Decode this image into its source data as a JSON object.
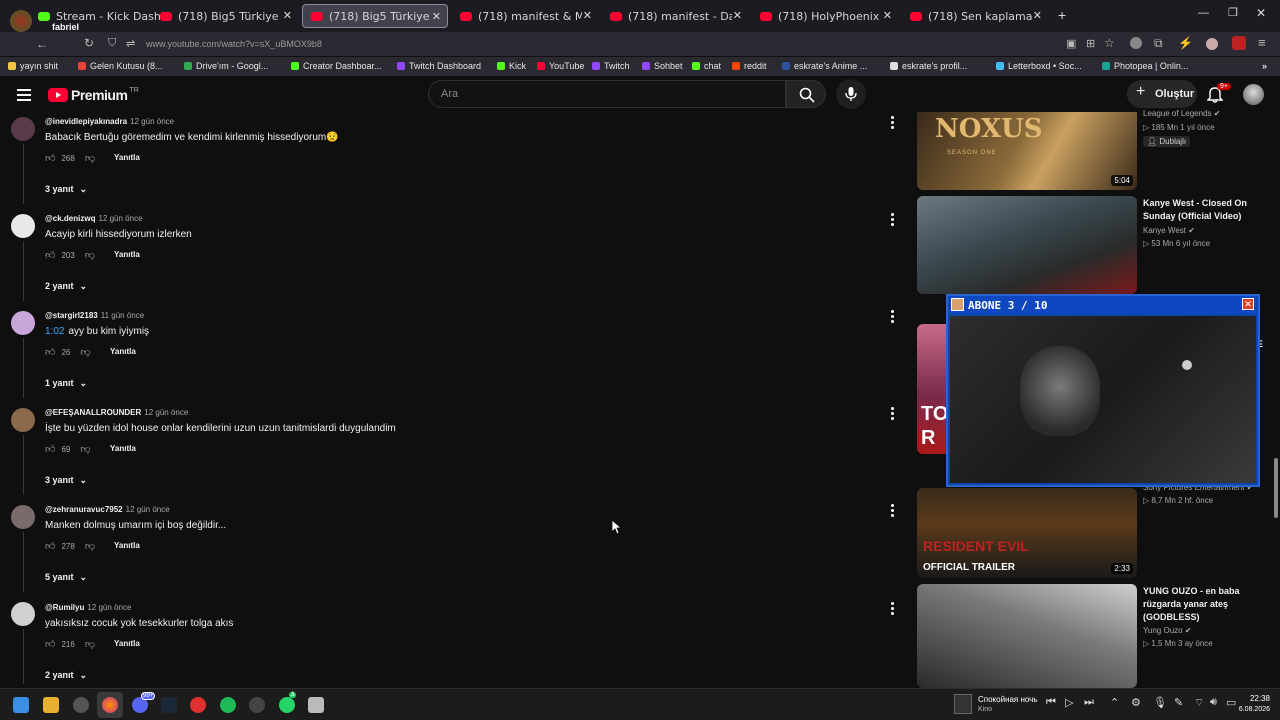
{
  "browser": {
    "profile_name": "fabriel",
    "tabs": [
      {
        "title": "Stream - Kick Dashbo",
        "kind": "kick"
      },
      {
        "title": "(718) Big5 Türkiye | Er",
        "kind": "yt"
      },
      {
        "title": "(718) Big5 Türkiye | Er",
        "kind": "yt",
        "active": true
      },
      {
        "title": "(718) manifest & Motive",
        "kind": "yt"
      },
      {
        "title": "(718) manifest - Daha İ",
        "kind": "yt"
      },
      {
        "title": "(718) HolyPhoenix - Ogu",
        "kind": "yt"
      },
      {
        "title": "(718) Sen kaplama işini",
        "kind": "yt"
      }
    ],
    "url": "www.youtube.com/watch?v=sX_uBMOX9b8",
    "bookmarks": [
      {
        "label": "yayın shit",
        "color": "#f4c542"
      },
      {
        "label": "Gelen Kutusu (8...",
        "color": "#ea4335"
      },
      {
        "label": "Drive'ım - Googl...",
        "color": "#34a853"
      },
      {
        "label": "Creator Dashboar...",
        "color": "#53fc18"
      },
      {
        "label": "Twitch Dashboard",
        "color": "#9146ff"
      },
      {
        "label": "Kick",
        "color": "#53fc18"
      },
      {
        "label": "YouTube",
        "color": "#ff0033"
      },
      {
        "label": "Twitch",
        "color": "#9146ff"
      },
      {
        "label": "Sohbet",
        "color": "#9146ff"
      },
      {
        "label": "chat",
        "color": "#53fc18"
      },
      {
        "label": "reddit",
        "color": "#ff4500"
      },
      {
        "label": "eskrate's Anime ...",
        "color": "#2e51a2"
      },
      {
        "label": "eskrate's profil...",
        "color": "#dddddd"
      },
      {
        "label": "Letterboxd • Soc...",
        "color": "#40bcf4"
      },
      {
        "label": "Photopea | Onlin...",
        "color": "#18a497"
      }
    ]
  },
  "youtube": {
    "logo_text": "Premium",
    "logo_region": "TR",
    "search_placeholder": "Ara",
    "create_label": "Oluştur",
    "notification_count": "9+"
  },
  "comments": [
    {
      "author": "@inevidlepiyakınadra",
      "time": "12 gün önce",
      "text": "Babacık Bertuğu göremedim ve kendimi kirlenmiş hissediyorum😟",
      "likes": "268",
      "reply_label": "Yanıtla",
      "replies": "3 yanıt",
      "avatar_color": "#5a3a4a"
    },
    {
      "author": "@ck.denizwq",
      "time": "12 gün önce",
      "text": "Acayip kirli hissediyorum izlerken",
      "likes": "203",
      "reply_label": "Yanıtla",
      "replies": "2 yanıt",
      "avatar_color": "#e8e8e8"
    },
    {
      "author": "@stargirl2183",
      "time": "11 gün önce",
      "timestamp": "1:02",
      "text": "ayy bu kim iyiymiş",
      "likes": "26",
      "reply_label": "Yanıtla",
      "replies": "1 yanıt",
      "avatar_color": "#c7a6d9"
    },
    {
      "author": "@EFEŞANALLROUNDER",
      "time": "12 gün önce",
      "text": "İşte bu yüzden idol house onlar kendilerini uzun uzun tanitmislardi duygulandim",
      "likes": "69",
      "reply_label": "Yanıtla",
      "replies": "3 yanıt",
      "avatar_color": "#8a6a4a"
    },
    {
      "author": "@zehranuravuc7952",
      "time": "12 gün önce",
      "text": "Manken dolmuş umarım içi boş değildir...",
      "likes": "278",
      "reply_label": "Yanıtla",
      "replies": "5 yanıt",
      "avatar_color": "#7a6a6a"
    },
    {
      "author": "@Rumilyu",
      "time": "12 gün önce",
      "text": "yakısıksız cocuk yok tesekkurler tolga akıs",
      "likes": "216",
      "reply_label": "Yanıtla",
      "replies": "2 yanıt",
      "avatar_color": "#d0d0d0"
    }
  ],
  "recommendations": [
    {
      "title_line": "League of Legends",
      "meta": "185 Mn   1 yıl önce",
      "badge": "Dublajlı",
      "duration": "5:04",
      "thumb_text": "NOXUS",
      "thumb_sub": "SEASON ONE"
    },
    {
      "title": "Kanye West - Closed On Sunday (Official Video)",
      "channel": "Kanye West",
      "meta": "53 Mn   6 yıl önce"
    },
    {
      "title_fragment": "E",
      "thumb_text": "TO R"
    },
    {
      "channel": "Sony Pictures Entertainment",
      "meta": "8,7 Mn   2 hf. önce",
      "duration": "2:33",
      "thumb_text": "RESIDENT EVIL",
      "thumb_sub": "OFFICIAL TRAILER"
    },
    {
      "title": "YUNG OUZO - en baba rüzgarda yanar ateş (GODBLESS)",
      "channel": "Yung Ouzo",
      "meta": "1,5 Mn   3 ay önce"
    }
  ],
  "overlay": {
    "label": "ABONE 3 / 10"
  },
  "taskbar": {
    "media_title": "Спокойная ночь",
    "media_artist": "Kino",
    "time": "22:38",
    "date": "6.08.2026",
    "badges": [
      "99+",
      "3"
    ]
  },
  "colors": {
    "yt_red": "#ff0033",
    "link_blue": "#3ea6ff",
    "bg": "#0f0f0f"
  }
}
